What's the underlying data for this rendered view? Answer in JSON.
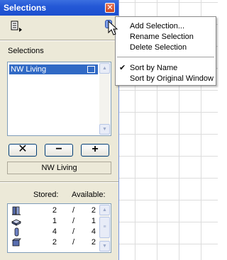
{
  "window": {
    "title": "Selections",
    "close_glyph": "✕"
  },
  "toolbar": {
    "list_menu_icon": "list-menu-icon",
    "options_icon": "options-menu-icon"
  },
  "selections": {
    "label": "Selections",
    "items": [
      {
        "label": "NW Living"
      }
    ],
    "current_name": "NW Living"
  },
  "buttons": {
    "remove_glyph": "✕",
    "minus_glyph": "−",
    "plus_glyph": "+"
  },
  "stock": {
    "col_stored": "Stored:",
    "col_available": "Available:",
    "separator": "/",
    "rows": [
      {
        "icon": "wall-icon",
        "stored": "2",
        "available": "2"
      },
      {
        "icon": "slab-icon",
        "stored": "1",
        "available": "1"
      },
      {
        "icon": "column-icon",
        "stored": "4",
        "available": "4"
      },
      {
        "icon": "object-icon",
        "stored": "2",
        "available": "2"
      }
    ]
  },
  "menu": {
    "items": [
      {
        "label": "Add Selection...",
        "checked": false
      },
      {
        "label": "Rename Selection",
        "checked": false
      },
      {
        "label": "Delete Selection",
        "checked": false
      },
      {
        "label": "Sort by Name",
        "checked": true
      },
      {
        "label": "Sort by Original Window",
        "checked": false
      }
    ],
    "check_glyph": "✔"
  },
  "colors": {
    "titlebar": "#2458d6",
    "selection_highlight": "#316ac5",
    "panel_bg": "#ece9d8"
  }
}
